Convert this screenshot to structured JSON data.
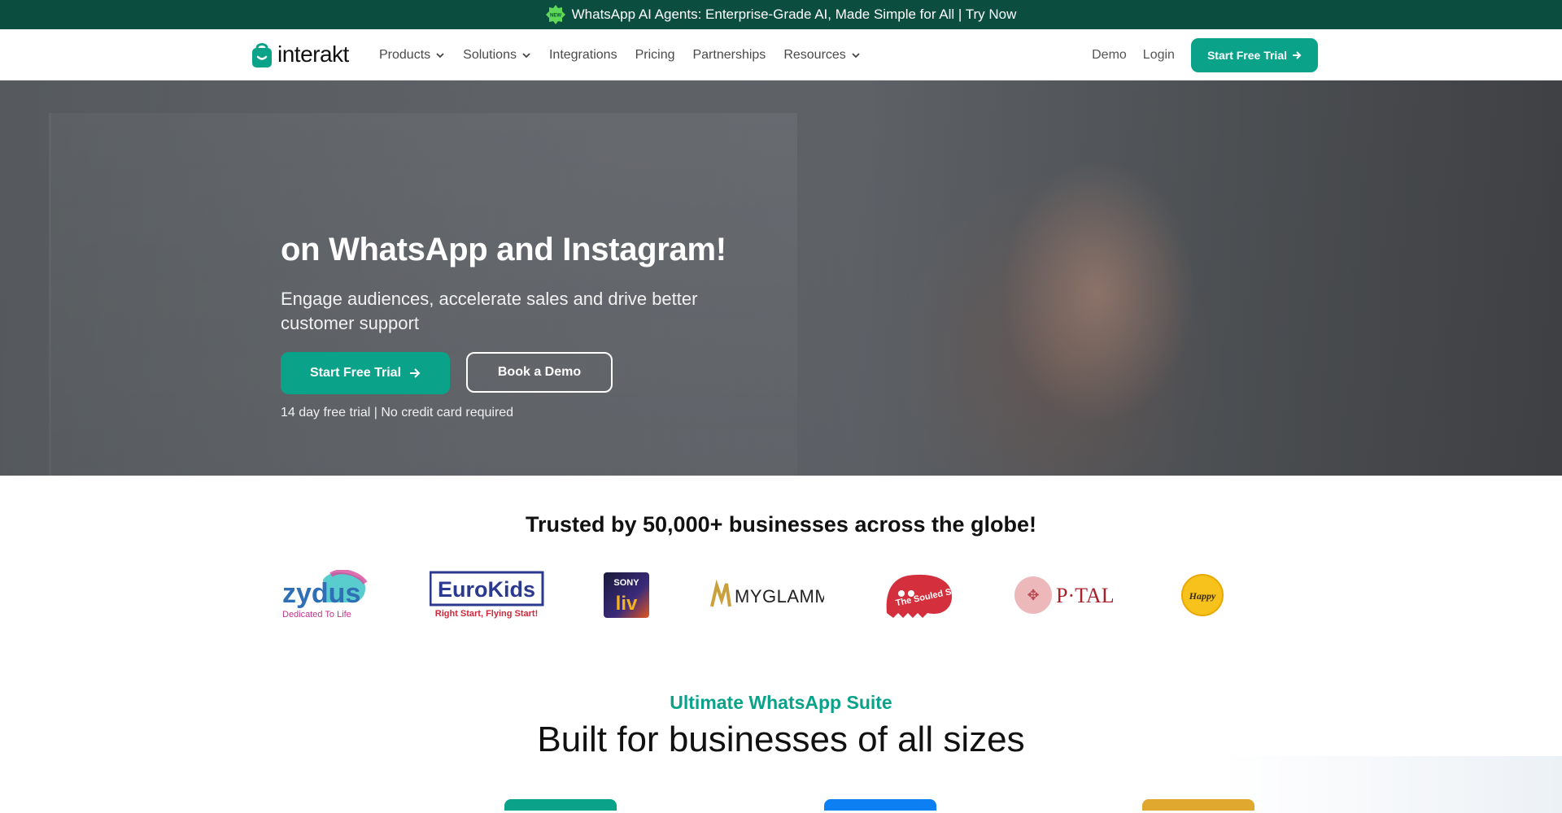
{
  "announcement": {
    "badge_text": "NEW",
    "text": "WhatsApp AI Agents: Enterprise-Grade AI, Made Simple for All | Try Now"
  },
  "nav": {
    "brand": "interakt",
    "menu": [
      {
        "label": "Products",
        "dropdown": true
      },
      {
        "label": "Solutions",
        "dropdown": true
      },
      {
        "label": "Integrations",
        "dropdown": false
      },
      {
        "label": "Pricing",
        "dropdown": false
      },
      {
        "label": "Partnerships",
        "dropdown": false
      },
      {
        "label": "Resources",
        "dropdown": true
      }
    ],
    "demo": "Demo",
    "login": "Login",
    "cta": "Start Free Trial"
  },
  "hero": {
    "title": "on WhatsApp and Instagram!",
    "subtitle": "Engage audiences, accelerate sales and drive better customer support",
    "primary_cta": "Start Free Trial",
    "secondary_cta": "Book a Demo",
    "note": "14 day free trial | No credit card required"
  },
  "trusted": {
    "heading": "Trusted by 50,000+ businesses across the globe!",
    "logos": [
      {
        "name": "zydus",
        "text": "zydus",
        "tagline": "Dedicated To Life"
      },
      {
        "name": "eurokids",
        "text": "EuroKids",
        "tagline": "Right Start, Flying Start!"
      },
      {
        "name": "sonyliv",
        "text": "SONY",
        "tagline": "liv"
      },
      {
        "name": "myglamm",
        "text": "MYGLAMM",
        "tagline": ""
      },
      {
        "name": "souled-store",
        "text": "The Souled Store",
        "tagline": ""
      },
      {
        "name": "ptal",
        "text": "P·TAL",
        "tagline": ""
      },
      {
        "name": "happy",
        "text": "Happy",
        "tagline": ""
      }
    ]
  },
  "suite": {
    "kicker": "Ultimate WhatsApp Suite",
    "title": "Built for businesses of all sizes"
  },
  "colors": {
    "brand_green": "#0aa38a",
    "announce_bg": "#0b4d3f",
    "blue": "#0c7ff2",
    "gold": "#e0a82e"
  }
}
